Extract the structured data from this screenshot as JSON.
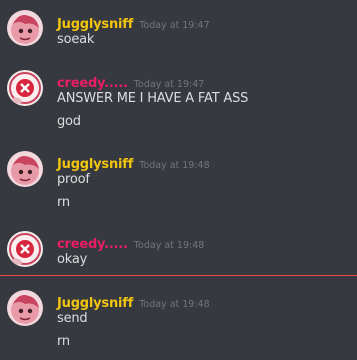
{
  "colors": {
    "background": "#36393f",
    "jugglysniff": "#f1c40f",
    "creedy": "#e91e63",
    "timestamp": "#72767d",
    "text": "#dcddde",
    "new_divider": "#f04747"
  },
  "messages": [
    {
      "username": "Jugglysniff",
      "timestamp": "Today at 19:47",
      "lines": [
        "soeak"
      ],
      "avatar": "pink-character-avatar-icon"
    },
    {
      "username": "creedy.....",
      "timestamp": "Today at 19:47",
      "lines": [
        "ANSWER ME I HAVE A FAT ASS",
        "god"
      ],
      "avatar": "eye-character-avatar-icon"
    },
    {
      "username": "Jugglysniff",
      "timestamp": "Today at 19:48",
      "lines": [
        "proof",
        "rn"
      ],
      "avatar": "pink-character-avatar-icon"
    },
    {
      "username": "creedy.....",
      "timestamp": "Today at 19:48",
      "lines": [
        "okay"
      ],
      "avatar": "eye-character-avatar-icon"
    },
    {
      "username": "Jugglysniff",
      "timestamp": "Today at 19:48",
      "lines": [
        "send",
        "rn"
      ],
      "avatar": "pink-character-avatar-icon"
    }
  ]
}
